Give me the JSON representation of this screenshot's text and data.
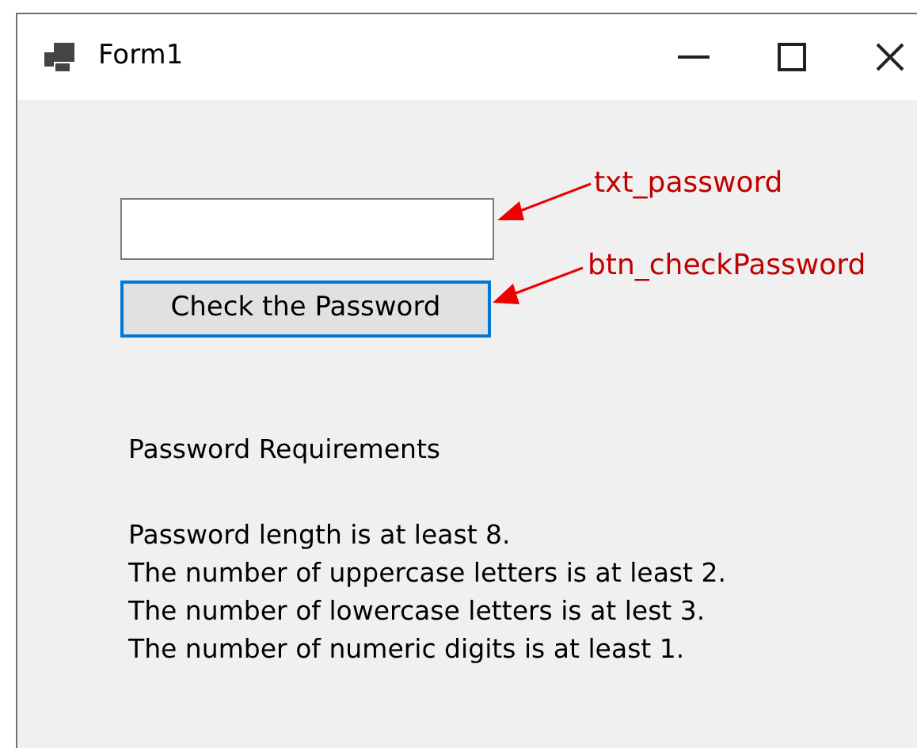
{
  "window": {
    "title": "Form1"
  },
  "check_button": {
    "label": "Check the Password",
    "focused": true
  },
  "annotations": [
    {
      "label": "txt_password"
    },
    {
      "label": "btn_checkPassword"
    }
  ],
  "requirements": {
    "heading": "Password Requirements",
    "lines": [
      "Password length is at least 8.",
      "The number of uppercase letters is at least 2.",
      "The number of lowercase letters is at lest 3.",
      "The number of numeric digits is at least 1."
    ]
  }
}
